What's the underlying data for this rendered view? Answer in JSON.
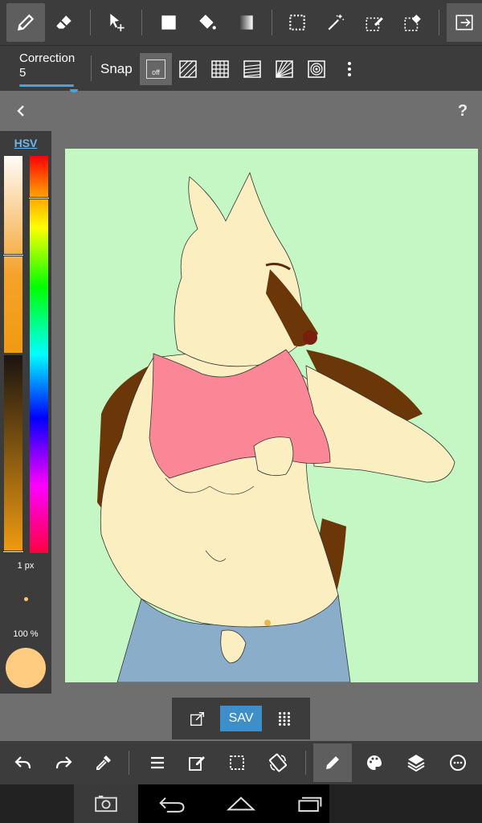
{
  "app": {
    "accent_color": "#4aa3df",
    "toolbar_bg": "#3c3c3c",
    "workspace_bg": "#6f6f6f"
  },
  "top_toolbar": {
    "tools": [
      "pencil-icon",
      "eraser-icon",
      "move-icon",
      "fill-rect-icon",
      "bucket-icon",
      "gradient-icon",
      "select-rect-icon",
      "magic-wand-icon",
      "select-pen-icon",
      "select-eraser-icon",
      "expand-icon"
    ],
    "active_tool": "pencil-icon"
  },
  "sub_toolbar": {
    "correction_label": "Correction",
    "correction_value": "5",
    "snap_label": "Snap",
    "snap_off_label": "off",
    "snap_modes": [
      "snap-off",
      "parallel-snap-icon",
      "grid-snap-icon",
      "perspective-snap-icon",
      "radial-snap-icon",
      "circle-snap-icon"
    ]
  },
  "color_panel": {
    "mode_tab": "HSV",
    "brush_size": "1 px",
    "opacity": "100 %",
    "current_color": "#ffcc80",
    "saturation_level": 0.5,
    "hue_level": 0.1
  },
  "canvas": {
    "background_color": "#c4f7c4"
  },
  "float_bar": {
    "save_label": "SAV"
  },
  "bottom_toolbar": {
    "tools": [
      "undo-icon",
      "redo-icon",
      "eyedropper-icon",
      "menu-icon",
      "edit-icon",
      "selection-icon",
      "rotate-icon",
      "pencil-icon",
      "palette-icon",
      "layers-icon",
      "more-icon"
    ],
    "active_tool": "pencil-icon"
  },
  "system_nav": {
    "buttons": [
      "screenshot-icon",
      "back-icon",
      "home-icon",
      "recents-icon"
    ]
  }
}
